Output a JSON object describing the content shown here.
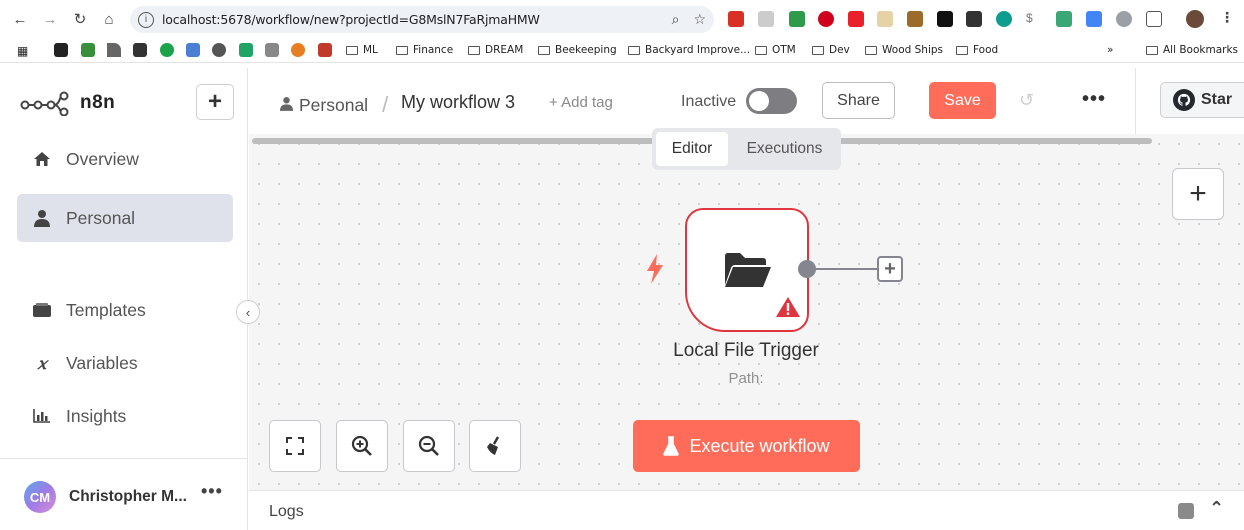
{
  "browser": {
    "url": "localhost:5678/workflow/new?projectId=G8MslN7FaRjmaHMW",
    "bookmarks": [
      "ML",
      "Finance",
      "DREAM",
      "Beekeeping",
      "Backyard Improve...",
      "OTM",
      "Dev",
      "Wood Ships",
      "Food"
    ],
    "all_bookmarks": "All Bookmarks",
    "overflow": "»"
  },
  "sidebar": {
    "logo": "n8n",
    "add_symbol": "+",
    "items": [
      {
        "label": "Overview",
        "icon": "home-icon"
      },
      {
        "label": "Personal",
        "icon": "user-icon",
        "active": true
      },
      {
        "label": "Templates",
        "icon": "templates-icon"
      },
      {
        "label": "Variables",
        "icon": "variables-icon"
      },
      {
        "label": "Insights",
        "icon": "insights-icon"
      }
    ],
    "user": {
      "initials": "CM",
      "name": "Christopher M...",
      "more": "•••"
    }
  },
  "header": {
    "project": "Personal",
    "separator": "/",
    "workflow_name": "My workflow 3",
    "add_tag": "+ Add tag",
    "status_label": "Inactive",
    "share": "Share",
    "save": "Save",
    "more": "•••",
    "github_star": "Star"
  },
  "tabs": {
    "editor": "Editor",
    "executions": "Executions"
  },
  "node": {
    "title": "Local File Trigger",
    "subtitle": "Path:"
  },
  "canvas": {
    "execute": "Execute workflow",
    "add_symbol": "+"
  },
  "logs": {
    "label": "Logs"
  },
  "colors": {
    "accent": "#ff6d5a",
    "error": "#e0353e",
    "sidebar_active": "#dfe2ea"
  }
}
